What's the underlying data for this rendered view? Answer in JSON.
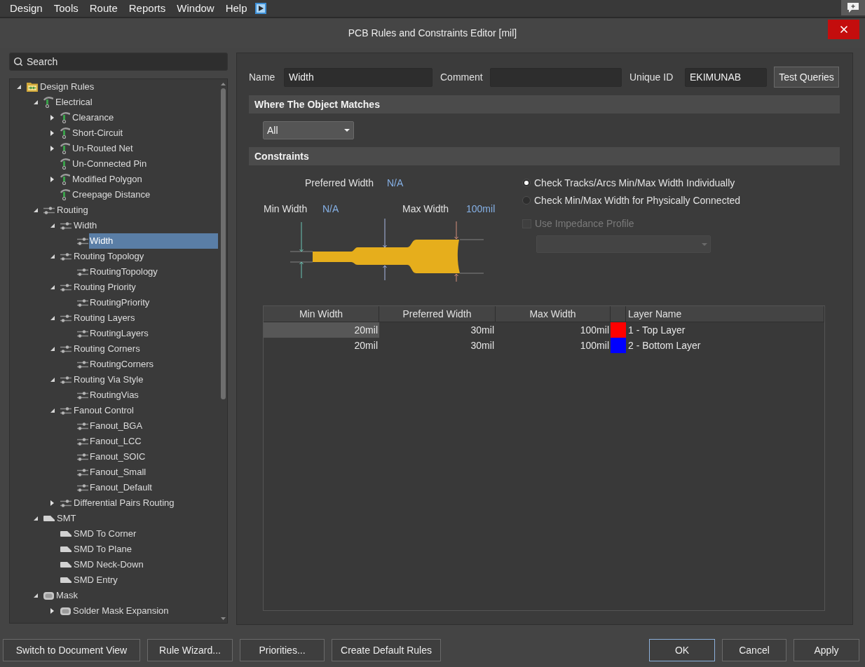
{
  "menu_bar": {
    "items": [
      "Design",
      "Tools",
      "Route",
      "Reports",
      "Window",
      "Help"
    ]
  },
  "dialog": {
    "title": "PCB Rules and Constraints Editor [mil]"
  },
  "search": {
    "placeholder": "Search"
  },
  "tree": [
    {
      "label": "Design Rules",
      "kind": "folder",
      "expanded": true,
      "selected": false,
      "children": [
        {
          "label": "Electrical",
          "kind": "electrical",
          "expanded": true,
          "selected": false,
          "children": [
            {
              "label": "Clearance",
              "kind": "electrical",
              "expanded": false,
              "selected": false
            },
            {
              "label": "Short-Circuit",
              "kind": "electrical",
              "expanded": false,
              "selected": false
            },
            {
              "label": "Un-Routed Net",
              "kind": "electrical",
              "expanded": false,
              "selected": false
            },
            {
              "label": "Un-Connected Pin",
              "kind": "electrical",
              "selected": false
            },
            {
              "label": "Modified Polygon",
              "kind": "electrical",
              "expanded": false,
              "selected": false
            },
            {
              "label": "Creepage Distance",
              "kind": "electrical",
              "selected": false
            }
          ]
        },
        {
          "label": "Routing",
          "kind": "routing",
          "expanded": true,
          "selected": false,
          "children": [
            {
              "label": "Width",
              "kind": "routing",
              "expanded": true,
              "selected": false,
              "children": [
                {
                  "label": "Width",
                  "kind": "routing",
                  "selected": true
                }
              ]
            },
            {
              "label": "Routing Topology",
              "kind": "routing",
              "expanded": true,
              "selected": false,
              "children": [
                {
                  "label": "RoutingTopology",
                  "kind": "routing",
                  "selected": false
                }
              ]
            },
            {
              "label": "Routing Priority",
              "kind": "routing",
              "expanded": true,
              "selected": false,
              "children": [
                {
                  "label": "RoutingPriority",
                  "kind": "routing",
                  "selected": false
                }
              ]
            },
            {
              "label": "Routing Layers",
              "kind": "routing",
              "expanded": true,
              "selected": false,
              "children": [
                {
                  "label": "RoutingLayers",
                  "kind": "routing",
                  "selected": false
                }
              ]
            },
            {
              "label": "Routing Corners",
              "kind": "routing",
              "expanded": true,
              "selected": false,
              "children": [
                {
                  "label": "RoutingCorners",
                  "kind": "routing",
                  "selected": false
                }
              ]
            },
            {
              "label": "Routing Via Style",
              "kind": "routing",
              "expanded": true,
              "selected": false,
              "children": [
                {
                  "label": "RoutingVias",
                  "kind": "routing",
                  "selected": false
                }
              ]
            },
            {
              "label": "Fanout Control",
              "kind": "routing",
              "expanded": true,
              "selected": false,
              "children": [
                {
                  "label": "Fanout_BGA",
                  "kind": "routing",
                  "selected": false
                },
                {
                  "label": "Fanout_LCC",
                  "kind": "routing",
                  "selected": false
                },
                {
                  "label": "Fanout_SOIC",
                  "kind": "routing",
                  "selected": false
                },
                {
                  "label": "Fanout_Small",
                  "kind": "routing",
                  "selected": false
                },
                {
                  "label": "Fanout_Default",
                  "kind": "routing",
                  "selected": false
                }
              ]
            },
            {
              "label": "Differential Pairs Routing",
              "kind": "routing",
              "expanded": false,
              "selected": false
            }
          ]
        },
        {
          "label": "SMT",
          "kind": "smt",
          "expanded": true,
          "selected": false,
          "children": [
            {
              "label": "SMD To Corner",
              "kind": "smt",
              "selected": false
            },
            {
              "label": "SMD To Plane",
              "kind": "smt",
              "selected": false
            },
            {
              "label": "SMD Neck-Down",
              "kind": "smt",
              "selected": false
            },
            {
              "label": "SMD Entry",
              "kind": "smt",
              "selected": false
            }
          ]
        },
        {
          "label": "Mask",
          "kind": "mask",
          "expanded": true,
          "selected": false,
          "children": [
            {
              "label": "Solder Mask Expansion",
              "kind": "mask",
              "expanded": false,
              "selected": false
            }
          ]
        }
      ]
    }
  ],
  "rule": {
    "fields": [
      {
        "label": "Name",
        "value": "Width"
      },
      {
        "label": "Comment"
      },
      {
        "label": "Unique ID",
        "value": "EKIMUNAB"
      }
    ],
    "test_queries_button": "Test Queries"
  },
  "where_matches": {
    "title": "Where The Object Matches",
    "scope": "All"
  },
  "constraints": {
    "title": "Constraints",
    "preferred_width": {
      "label": "Preferred Width",
      "value": "N/A"
    },
    "min_width": {
      "label": "Min Width",
      "value": "N/A"
    },
    "max_width": {
      "label": "Max Width",
      "value": "100mil"
    },
    "width_check_options": [
      {
        "label": "Check Tracks/Arcs Min/Max Width Individually",
        "selected": true
      },
      {
        "label": "Check Min/Max Width for Physically Connected",
        "selected": false
      }
    ],
    "impedance_profile": {
      "label": "Use Impedance Profile",
      "checked": false,
      "disabled": true
    },
    "profile_dropdown": {
      "disabled": true
    }
  },
  "layer_table": {
    "columns": [
      "Min Width",
      "Preferred Width",
      "Max Width",
      "Layer Name"
    ],
    "rows": [
      {
        "min_width": "20mil",
        "preferred_width": "30mil",
        "max_width": "100mil",
        "color": "#ff0000",
        "layer_name": "1 - Top Layer",
        "selected": true
      },
      {
        "min_width": "20mil",
        "preferred_width": "30mil",
        "max_width": "100mil",
        "color": "#0000ff",
        "layer_name": "2 - Bottom Layer",
        "selected": false
      }
    ]
  },
  "left_buttons": [
    "Switch to Document View",
    "Rule Wizard...",
    "Priorities...",
    "Create Default Rules"
  ],
  "dialog_buttons": [
    {
      "label": "OK",
      "default": true
    },
    {
      "label": "Cancel",
      "default": false
    },
    {
      "label": "Apply",
      "default": false
    }
  ]
}
